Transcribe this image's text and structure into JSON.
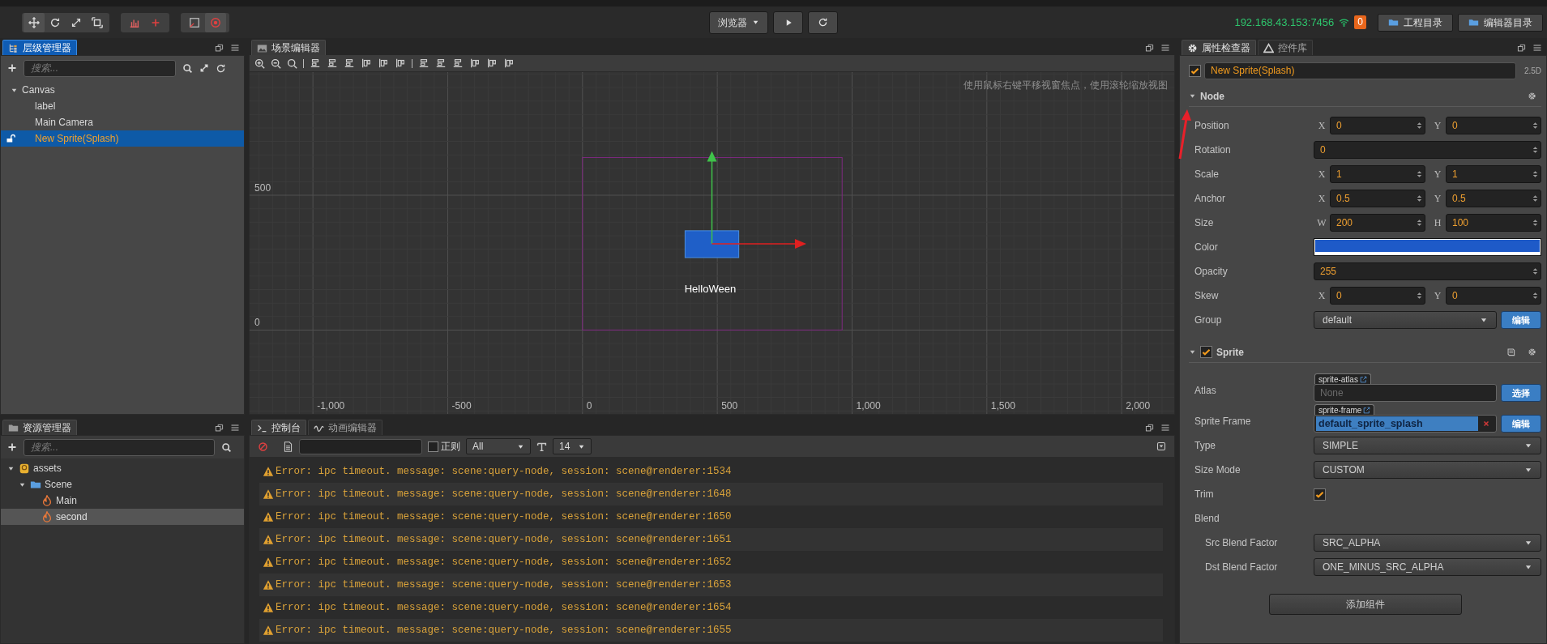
{
  "toolbar": {
    "preview_target": "浏览器",
    "ip_address": "192.168.43.153:7456",
    "notice_count": "0",
    "folder_buttons": [
      "工程目录",
      "编辑器目录"
    ]
  },
  "hierarchy": {
    "tab": "层级管理器",
    "search_placeholder": "搜索...",
    "tree": [
      {
        "label": "Canvas",
        "expanded": true,
        "selected": false,
        "children": [
          {
            "label": "label",
            "selected": false
          },
          {
            "label": "Main Camera",
            "selected": false
          },
          {
            "label": "New Sprite(Splash)",
            "selected": true
          }
        ]
      }
    ]
  },
  "assets": {
    "tab": "资源管理器",
    "search_placeholder": "搜索...",
    "tree": [
      {
        "label": "assets",
        "kind": "database",
        "expanded": true,
        "selected": false,
        "children": [
          {
            "label": "Scene",
            "kind": "folder",
            "expanded": true,
            "selected": false,
            "children": [
              {
                "label": "Main",
                "kind": "scene",
                "selected": false
              },
              {
                "label": "second",
                "kind": "scene",
                "selected": true
              }
            ]
          }
        ]
      }
    ]
  },
  "scene": {
    "tab": "场景编辑器",
    "hint": "使用鼠标右键平移视窗焦点，使用滚轮缩放视图",
    "x_labels": [
      "-1,000",
      "-500",
      "0",
      "500",
      "1,000",
      "1,500",
      "2,000"
    ],
    "y_labels": [
      "500",
      "0"
    ],
    "node_label": "HelloWeen"
  },
  "console": {
    "tabs": [
      {
        "label": "控制台",
        "selected": true
      },
      {
        "label": "动画编辑器",
        "selected": false
      }
    ],
    "regex_label": "正则",
    "regex_checked": false,
    "level_filter": "All",
    "font_size": "14",
    "messages": [
      "Error: ipc timeout. message: scene:query-node, session: scene@renderer:1534",
      "Error: ipc timeout. message: scene:query-node, session: scene@renderer:1648",
      "Error: ipc timeout. message: scene:query-node, session: scene@renderer:1650",
      "Error: ipc timeout. message: scene:query-node, session: scene@renderer:1651",
      "Error: ipc timeout. message: scene:query-node, session: scene@renderer:1652",
      "Error: ipc timeout. message: scene:query-node, session: scene@renderer:1653",
      "Error: ipc timeout. message: scene:query-node, session: scene@renderer:1654",
      "Error: ipc timeout. message: scene:query-node, session: scene@renderer:1655"
    ]
  },
  "inspector": {
    "tabs": [
      {
        "label": "属性检查器",
        "selected": true
      },
      {
        "label": "控件库",
        "selected": false
      }
    ],
    "node_active": true,
    "node_name": "New Sprite(Splash)",
    "mode": "2.5D",
    "sections": [
      {
        "kind": "node",
        "title": "Node",
        "expanded": true,
        "properties": [
          {
            "kind": "vec2",
            "label": "Position",
            "fields": [
              {
                "axis": "X",
                "value": "0"
              },
              {
                "axis": "Y",
                "value": "0"
              }
            ]
          },
          {
            "kind": "number",
            "label": "Rotation",
            "value": "0"
          },
          {
            "kind": "vec2",
            "label": "Scale",
            "fields": [
              {
                "axis": "X",
                "value": "1"
              },
              {
                "axis": "Y",
                "value": "1"
              }
            ]
          },
          {
            "kind": "vec2",
            "label": "Anchor",
            "fields": [
              {
                "axis": "X",
                "value": "0.5"
              },
              {
                "axis": "Y",
                "value": "0.5"
              }
            ]
          },
          {
            "kind": "vec2",
            "label": "Size",
            "fields": [
              {
                "axis": "W",
                "value": "200"
              },
              {
                "axis": "H",
                "value": "100"
              }
            ]
          },
          {
            "kind": "color",
            "label": "Color",
            "color": "#1e5ac8"
          },
          {
            "kind": "number",
            "label": "Opacity",
            "value": "255"
          },
          {
            "kind": "vec2",
            "label": "Skew",
            "fields": [
              {
                "axis": "X",
                "value": "0"
              },
              {
                "axis": "Y",
                "value": "0"
              }
            ]
          },
          {
            "kind": "select",
            "label": "Group",
            "value": "default",
            "button": "编辑"
          }
        ]
      },
      {
        "kind": "component",
        "title": "Sprite",
        "expanded": true,
        "enabled": true,
        "properties": [
          {
            "kind": "asset",
            "label": "Atlas",
            "asset_type": "sprite-atlas",
            "placeholder": "None",
            "button": "选择"
          },
          {
            "kind": "asset",
            "label": "Sprite Frame",
            "asset_type": "sprite-frame",
            "value": "default_sprite_splash",
            "button": "编辑"
          },
          {
            "kind": "select",
            "label": "Type",
            "value": "SIMPLE"
          },
          {
            "kind": "select",
            "label": "Size Mode",
            "value": "CUSTOM"
          },
          {
            "kind": "checkbox",
            "label": "Trim",
            "checked": true
          },
          {
            "kind": "group",
            "label": "Blend",
            "children": [
              {
                "kind": "select",
                "label": "Src Blend Factor",
                "value": "SRC_ALPHA"
              },
              {
                "kind": "select",
                "label": "Dst Blend Factor",
                "value": "ONE_MINUS_SRC_ALPHA"
              }
            ]
          }
        ]
      }
    ],
    "add_component": "添加组件"
  }
}
